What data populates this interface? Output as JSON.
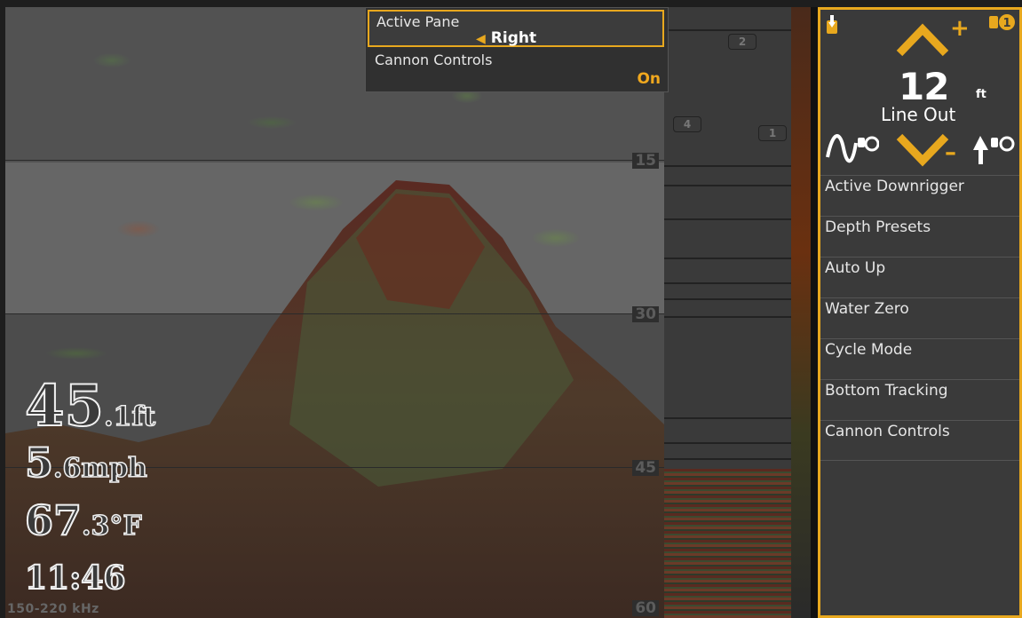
{
  "depth_scale": [
    "15",
    "30",
    "45",
    "60"
  ],
  "readouts": {
    "depth_value": "45",
    "depth_unit": ".1ft",
    "speed_value": "5",
    "speed_unit": ".6mph",
    "temp_value": "67",
    "temp_unit": ".3°F",
    "time": "11:46"
  },
  "frequency_label": "150-220 kHz",
  "trackers": [
    "2",
    "4",
    "1"
  ],
  "popup": {
    "active_pane_label": "Active Pane",
    "active_pane_value": "Right",
    "cannon_controls_label": "Cannon Controls",
    "cannon_controls_value": "On"
  },
  "downrigger": {
    "badge": "1",
    "line_out_value": "12",
    "line_out_unit": "ft",
    "line_out_label": "Line Out",
    "plus": "+",
    "minus": "–"
  },
  "menu": [
    "Active Downrigger",
    "Depth Presets",
    "Auto Up",
    "Water Zero",
    "Cycle Mode",
    "Bottom Tracking",
    "Cannon Controls"
  ],
  "colors": {
    "accent": "#e8a81e",
    "panel_bg": "#3a3a3a",
    "popup_bg": "#303030"
  }
}
